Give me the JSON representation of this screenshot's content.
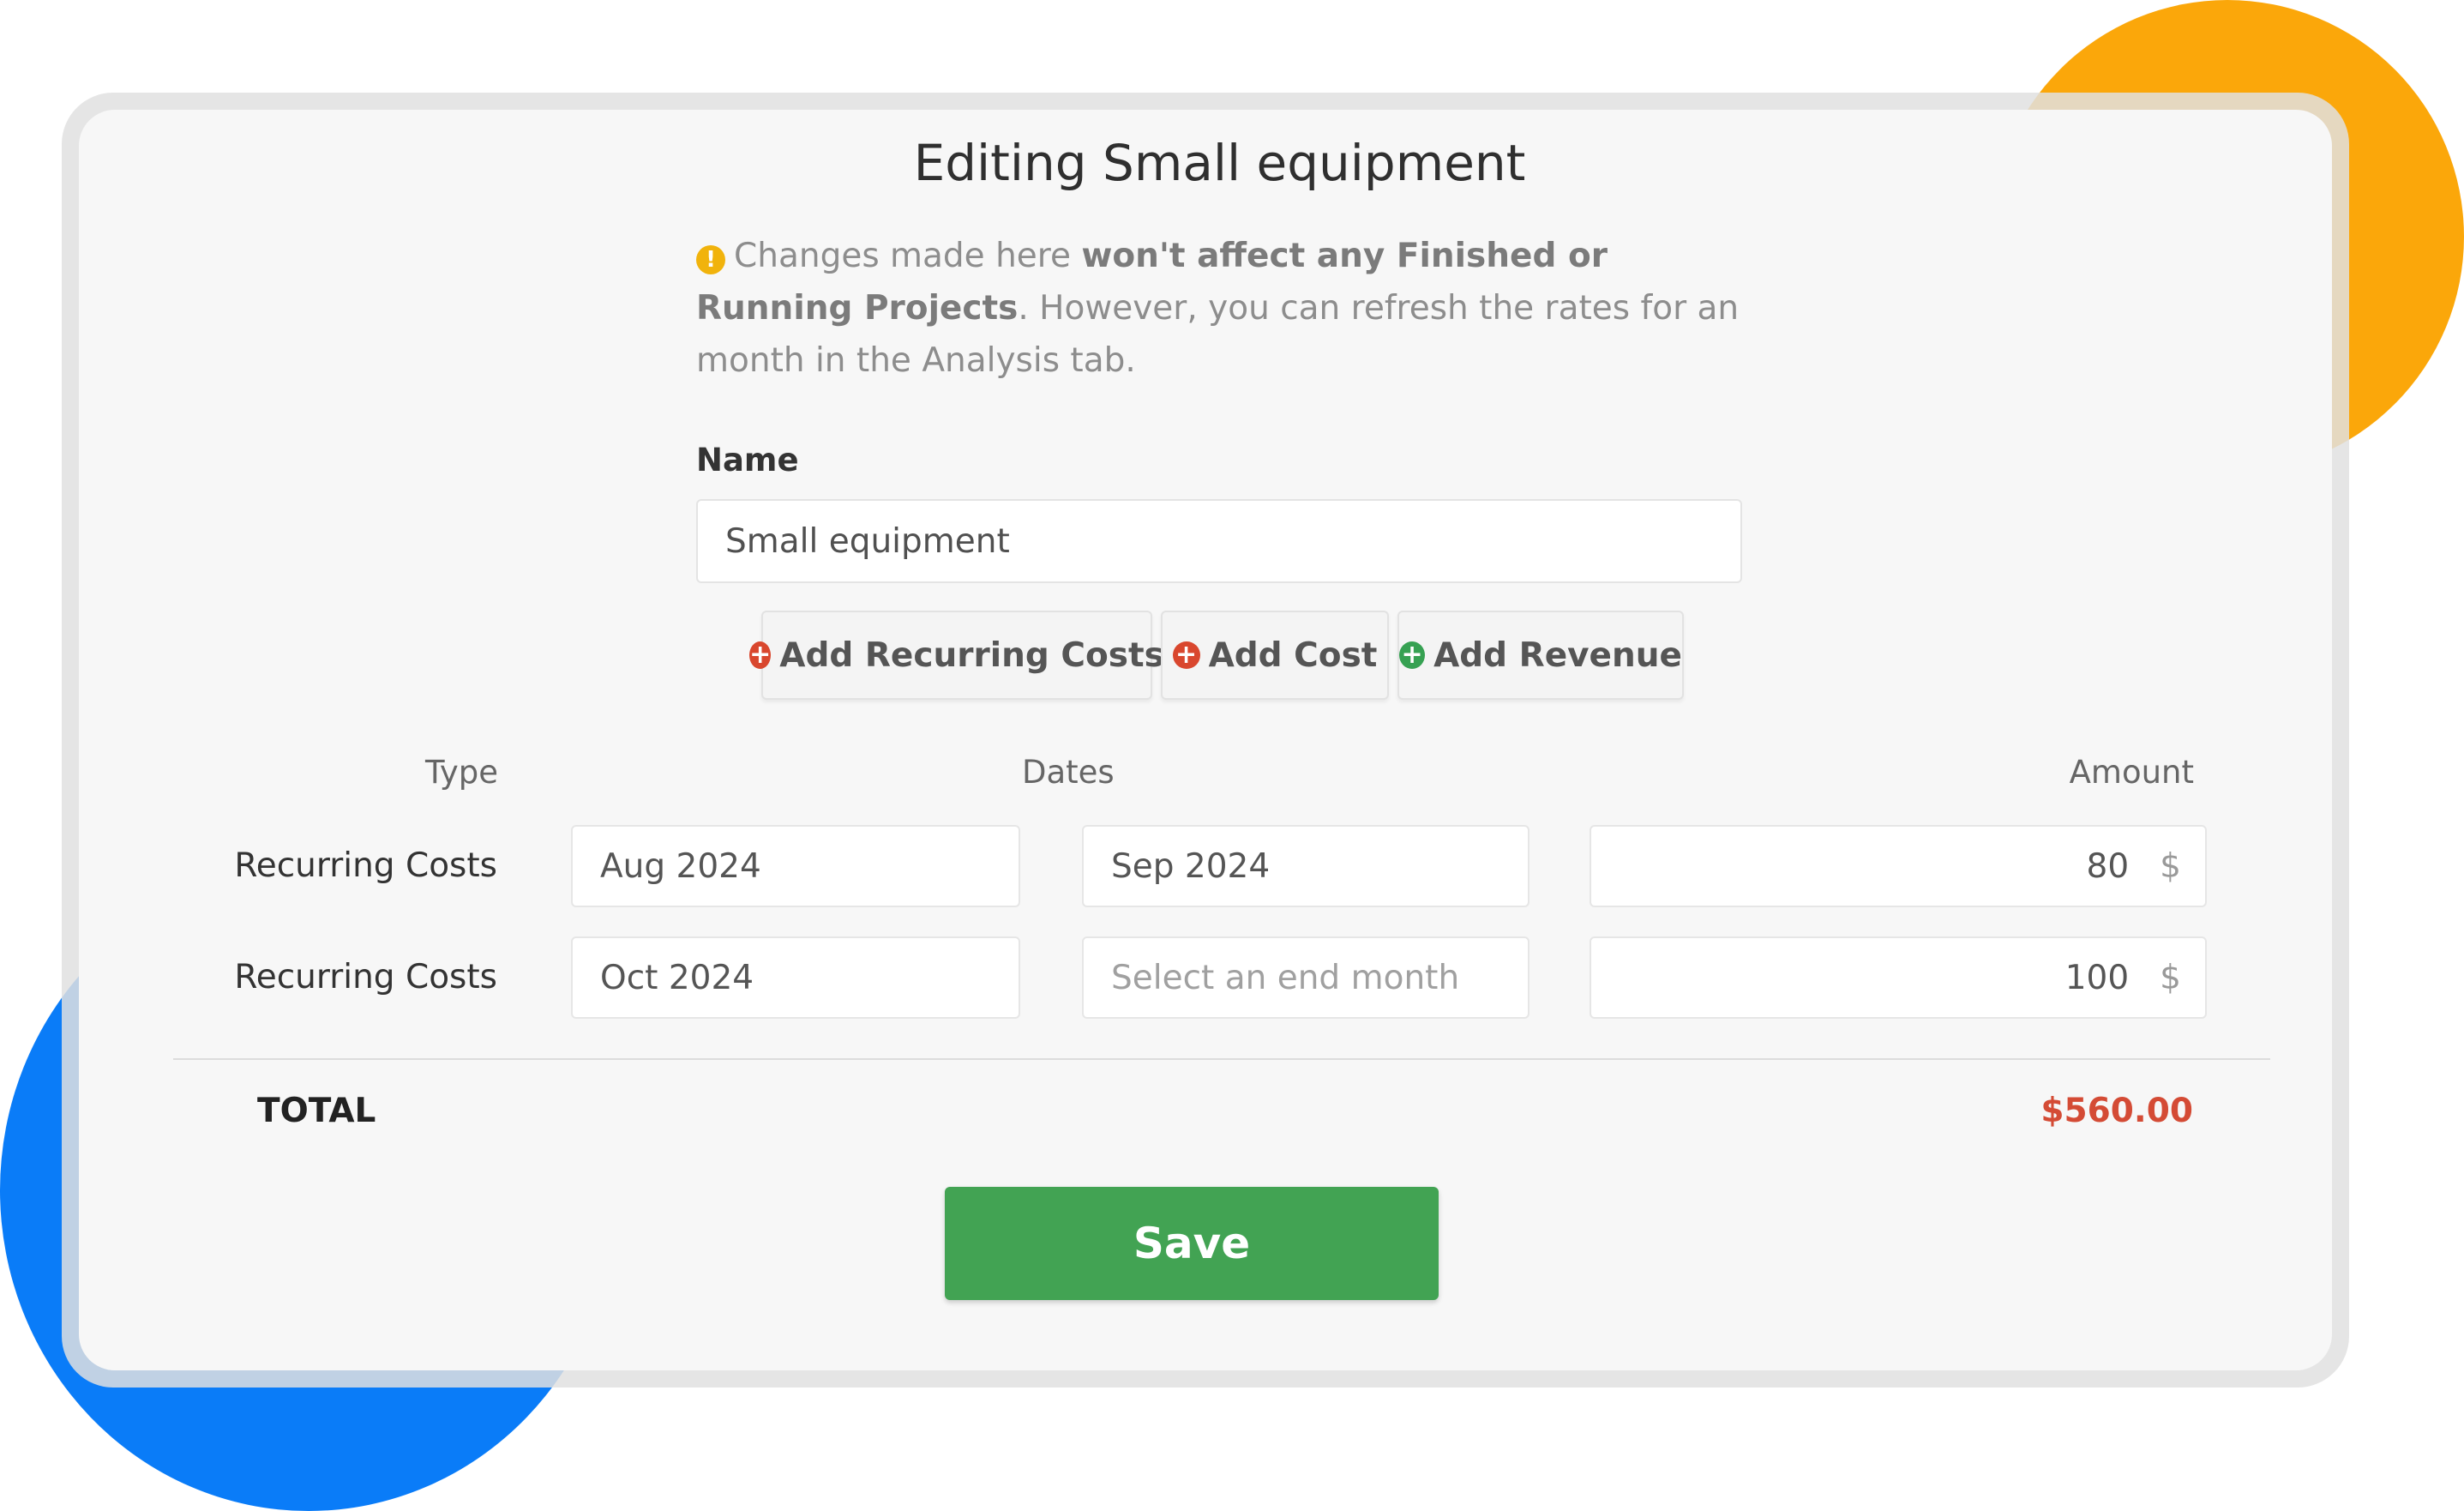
{
  "colors": {
    "accent_orange": "#fba70a",
    "accent_blue": "#0a7cf8",
    "save_green": "#42a353",
    "total_red": "#d44b35",
    "warning_yellow": "#f1b30c"
  },
  "dialog": {
    "title": "Editing Small equipment",
    "notice": {
      "icon": "warning-icon",
      "text_before": "Changes made here ",
      "text_bold": "won't affect any Finished or Running Projects",
      "text_after": ". However, you can refresh the rates for an month in the Analysis tab."
    },
    "name_label": "Name",
    "name_value": "Small equipment"
  },
  "actions": {
    "add_recurring": "Add Recurring Costs",
    "add_cost": "Add Cost",
    "add_revenue": "Add Revenue"
  },
  "table": {
    "headers": {
      "type": "Type",
      "dates": "Dates",
      "amount": "Amount"
    },
    "rows": [
      {
        "type": "Recurring Costs",
        "start": "Aug 2024",
        "end": "Sep 2024",
        "end_is_placeholder": false,
        "amount": "80",
        "currency": "$"
      },
      {
        "type": "Recurring Costs",
        "start": "Oct 2024",
        "end": "Select an end month",
        "end_is_placeholder": true,
        "amount": "100",
        "currency": "$"
      }
    ]
  },
  "total": {
    "label": "TOTAL",
    "value": "$560.00"
  },
  "save_label": "Save"
}
